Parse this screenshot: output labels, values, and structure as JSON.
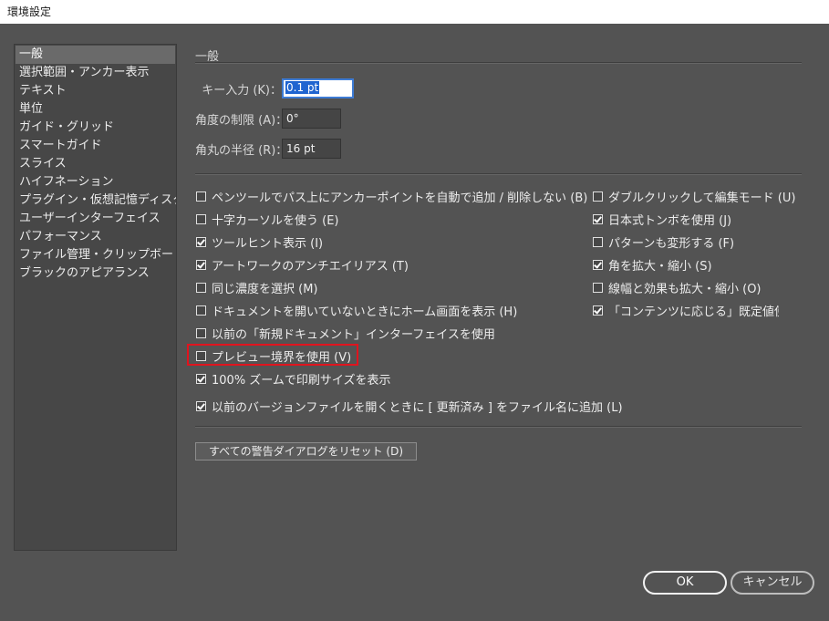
{
  "window": {
    "title": "環境設定"
  },
  "sidebar": {
    "items": [
      {
        "label": "一般"
      },
      {
        "label": "選択範囲・アンカー表示"
      },
      {
        "label": "テキスト"
      },
      {
        "label": "単位"
      },
      {
        "label": "ガイド・グリッド"
      },
      {
        "label": "スマートガイド"
      },
      {
        "label": "スライス"
      },
      {
        "label": "ハイフネーション"
      },
      {
        "label": "プラグイン・仮想記憶ディスク"
      },
      {
        "label": "ユーザーインターフェイス"
      },
      {
        "label": "パフォーマンス"
      },
      {
        "label": "ファイル管理・クリップボード"
      },
      {
        "label": "ブラックのアピアランス"
      }
    ],
    "selected": "一般"
  },
  "main": {
    "section_title": "一般",
    "fields": {
      "key_input": {
        "label": "キー入力 (K)：",
        "value": "0.1 pt"
      },
      "angle_limit": {
        "label": "角度の制限 (A)：",
        "value": "0°"
      },
      "corner_radius": {
        "label": "角丸の半径 (R)：",
        "value": "16 pt"
      }
    },
    "left_options": [
      {
        "label": "ペンツールでパス上にアンカーポイントを自動で追加 / 削除しない (B)",
        "checked": false
      },
      {
        "label": "十字カーソルを使う (E)",
        "checked": false
      },
      {
        "label": "ツールヒント表示 (I)",
        "checked": true
      },
      {
        "label": "アートワークのアンチエイリアス (T)",
        "checked": true
      },
      {
        "label": "同じ濃度を選択 (M)",
        "checked": false
      },
      {
        "label": "ドキュメントを開いていないときにホーム画面を表示 (H)",
        "checked": false
      },
      {
        "label": "以前の「新規ドキュメント」インターフェイスを使用",
        "checked": false
      },
      {
        "label": "プレビュー境界を使用 (V)",
        "checked": false
      },
      {
        "label": "100% ズームで印刷サイズを表示",
        "checked": true
      },
      {
        "label": "以前のバージョンファイルを開くときに [ 更新済み ] をファイル名に追加 (L)",
        "checked": true
      }
    ],
    "right_options": [
      {
        "label": "ダブルクリックして編集モード (U)",
        "checked": false
      },
      {
        "label": "日本式トンボを使用 (J)",
        "checked": true
      },
      {
        "label": "パターンも変形する (F)",
        "checked": false
      },
      {
        "label": "角を拡大・縮小 (S)",
        "checked": true
      },
      {
        "label": "線幅と効果も拡大・縮小 (O)",
        "checked": false
      },
      {
        "label": "「コンテンツに応じる」既定値使用",
        "checked": true
      }
    ],
    "reset_button": "すべての警告ダイアログをリセット (D)"
  },
  "footer": {
    "ok_label": "OK",
    "cancel_label": "キャンセル"
  },
  "colors": {
    "background": "#535353",
    "highlight": "#e0141e",
    "selection": "#1f64d0"
  }
}
